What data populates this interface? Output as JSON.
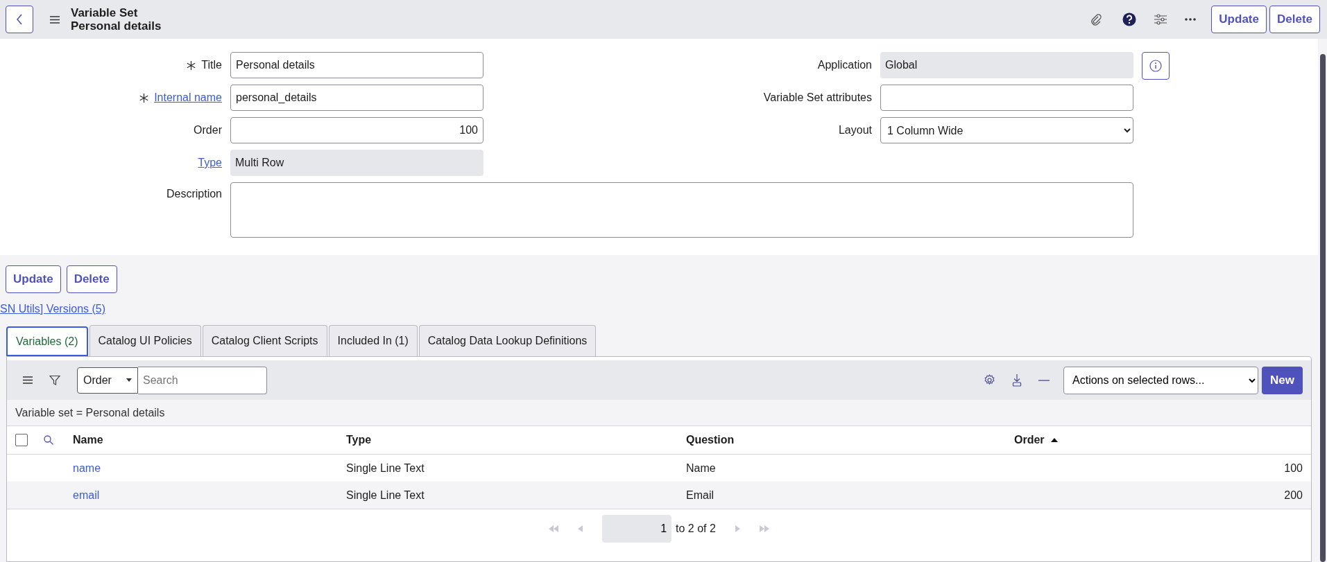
{
  "header": {
    "title": "Variable Set",
    "subtitle": "Personal details",
    "buttons": [
      "Update",
      "Delete"
    ]
  },
  "form": {
    "rows": [
      {
        "left": {
          "label": "Title",
          "required": true,
          "link": false,
          "kind": "text",
          "value": "Personal details"
        },
        "right": {
          "label": "Application",
          "kind": "readonly",
          "value": "Global",
          "info": true
        }
      },
      {
        "left": {
          "label": "Internal name",
          "required": true,
          "link": true,
          "kind": "text",
          "value": "personal_details"
        },
        "right": {
          "label": "Variable Set attributes",
          "kind": "text",
          "info": false
        }
      },
      {
        "left": {
          "label": "Order",
          "required": false,
          "link": false,
          "kind": "number",
          "value": "100"
        },
        "right": {
          "label": "Layout",
          "kind": "select",
          "value": "1 Column Wide",
          "info": false
        }
      },
      {
        "left": {
          "label": "Type",
          "required": false,
          "link": true,
          "kind": "readonly",
          "value": "Multi Row"
        }
      }
    ],
    "description": {
      "label": "Description"
    }
  },
  "buttons": [
    "Update",
    "Delete"
  ],
  "versions_link": "SN Utils] Versions (5)",
  "tabs": [
    {
      "label": "Variables (2)",
      "selected": true
    },
    {
      "label": "Catalog UI Policies",
      "selected": false
    },
    {
      "label": "Catalog Client Scripts",
      "selected": false
    },
    {
      "label": "Included In (1)",
      "selected": false
    },
    {
      "label": "Catalog Data Lookup Definitions",
      "selected": false
    }
  ],
  "list": {
    "field_select": "Order",
    "search_placeholder": "Search",
    "actions_select": "Actions on selected rows...",
    "new_button": "New",
    "select_all_checked": false,
    "filter": "Variable set = Personal details",
    "columns": [
      {
        "label": "Name",
        "sorted": false
      },
      {
        "label": "Type",
        "sorted": false
      },
      {
        "label": "Question",
        "sorted": false
      },
      {
        "label": "Order",
        "sorted": true
      }
    ],
    "rows": [
      {
        "name": "name",
        "type": "Single Line Text",
        "question": "Name",
        "order": "100"
      },
      {
        "name": "email",
        "type": "Single Line Text",
        "question": "Email",
        "order": "200"
      }
    ],
    "pagination": {
      "page": "1",
      "range": "to 2 of 2"
    }
  }
}
